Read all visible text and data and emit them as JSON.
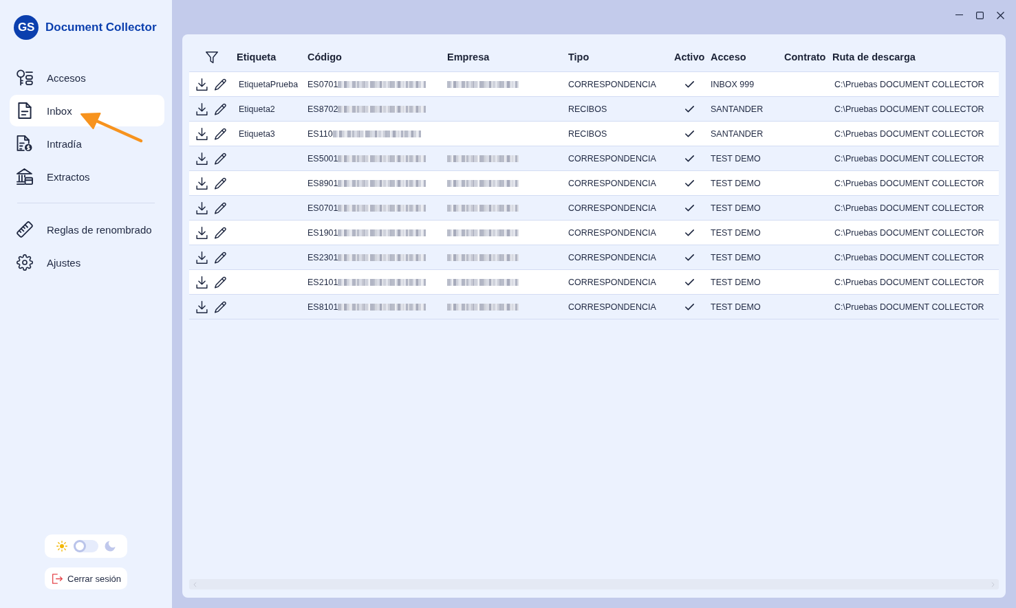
{
  "sidebar": {
    "logo": {
      "initials": "GS",
      "title": "Document Collector"
    },
    "nav_groups": [
      {
        "items": [
          {
            "kind": "keys",
            "label": "Accesos",
            "selected": false
          },
          {
            "kind": "document",
            "label": "Inbox",
            "selected": true
          },
          {
            "kind": "invoice",
            "label": "Intradía",
            "selected": false
          },
          {
            "kind": "bank",
            "label": "Extractos",
            "selected": false
          }
        ]
      },
      {
        "items": [
          {
            "kind": "ruler",
            "label": "Reglas de renombrado",
            "selected": false
          },
          {
            "kind": "gear",
            "label": "Ajustes",
            "selected": false
          }
        ]
      }
    ],
    "theme_toggle": {
      "on": false
    },
    "logout_button": {
      "label": "Cerrar sesión"
    }
  },
  "table": {
    "columns": [
      "Etiqueta",
      "Código",
      "Empresa",
      "Tipo",
      "Activo",
      "Acceso",
      "Contrato",
      "Ruta de descarga"
    ],
    "rows": [
      {
        "etiqueta": "EtiquetaPrueba",
        "codigo": "ES0701",
        "codigo_blurred": true,
        "empresa_blurred": true,
        "tipo": "CORRESPONDENCIA",
        "activo": true,
        "acceso": "INBOX 999",
        "ruta": "C:\\Pruebas DOCUMENT COLLECTOR"
      },
      {
        "etiqueta": "Etiqueta2",
        "codigo": "ES8702",
        "codigo_blurred": true,
        "empresa_blurred": false,
        "tipo": "RECIBOS",
        "activo": true,
        "acceso": "SANTANDER",
        "ruta": "C:\\Pruebas DOCUMENT COLLECTOR"
      },
      {
        "etiqueta": "Etiqueta3",
        "codigo": "ES110",
        "codigo_blurred": true,
        "empresa_blurred": false,
        "tipo": "RECIBOS",
        "activo": true,
        "acceso": "SANTANDER",
        "ruta": "C:\\Pruebas DOCUMENT COLLECTOR"
      },
      {
        "codigo": "ES5001",
        "codigo_blurred": true,
        "empresa_blurred": true,
        "tipo": "CORRESPONDENCIA",
        "activo": true,
        "acceso": "TEST DEMO",
        "ruta": "C:\\Pruebas DOCUMENT COLLECTOR"
      },
      {
        "codigo": "ES8901",
        "codigo_blurred": true,
        "empresa_blurred": true,
        "tipo": "CORRESPONDENCIA",
        "activo": true,
        "acceso": "TEST DEMO",
        "ruta": "C:\\Pruebas DOCUMENT COLLECTOR"
      },
      {
        "codigo": "ES0701",
        "codigo_blurred": true,
        "empresa_blurred": true,
        "tipo": "CORRESPONDENCIA",
        "activo": true,
        "acceso": "TEST DEMO",
        "ruta": "C:\\Pruebas DOCUMENT COLLECTOR"
      },
      {
        "codigo": "ES1901",
        "codigo_blurred": true,
        "empresa_blurred": true,
        "tipo": "CORRESPONDENCIA",
        "activo": true,
        "acceso": "TEST DEMO",
        "ruta": "C:\\Pruebas DOCUMENT COLLECTOR"
      },
      {
        "codigo": "ES2301",
        "codigo_blurred": true,
        "empresa_blurred": true,
        "tipo": "CORRESPONDENCIA",
        "activo": true,
        "acceso": "TEST DEMO",
        "ruta": "C:\\Pruebas DOCUMENT COLLECTOR"
      },
      {
        "codigo": "ES2101",
        "codigo_blurred": true,
        "empresa_blurred": true,
        "tipo": "CORRESPONDENCIA",
        "activo": true,
        "acceso": "TEST DEMO",
        "ruta": "C:\\Pruebas DOCUMENT COLLECTOR"
      },
      {
        "codigo": "ES8101",
        "codigo_blurred": true,
        "empresa_blurred": true,
        "tipo": "CORRESPONDENCIA",
        "activo": true,
        "acceso": "TEST DEMO",
        "ruta": "C:\\Pruebas DOCUMENT COLLECTOR"
      }
    ]
  }
}
